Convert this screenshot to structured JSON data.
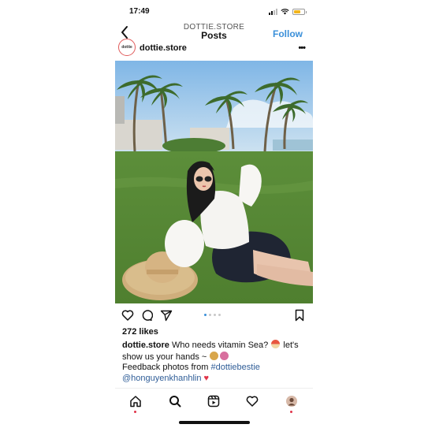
{
  "status_bar": {
    "time": "17:49",
    "battery_level": 0.7
  },
  "header": {
    "account_label": "DOTTIE.STORE",
    "title": "Posts",
    "follow_label": "Follow"
  },
  "post": {
    "avatar_text": "dottie",
    "username": "dottie.store",
    "carousel": {
      "count": 4,
      "active_index": 0
    },
    "likes": "272 likes",
    "caption": {
      "username": "dottie.store",
      "line1": "Who needs vitamin Sea?",
      "line1b": "let's show us your hands ~",
      "line2": "Feedback photos from",
      "hashtag": "#dottiebestie",
      "mention": "@honguyenkhanhlin"
    }
  },
  "icons": {
    "back": "chevron-left-icon",
    "more": "more-horizontal-icon",
    "like": "heart-icon",
    "comment": "comment-icon",
    "share": "send-icon",
    "save": "bookmark-icon"
  },
  "nav": [
    "home-icon",
    "search-icon",
    "reels-icon",
    "activity-icon",
    "profile-avatar"
  ],
  "colors": {
    "accent": "#3a8fd9",
    "link": "#2f5d97",
    "notification": "#e0344a"
  }
}
